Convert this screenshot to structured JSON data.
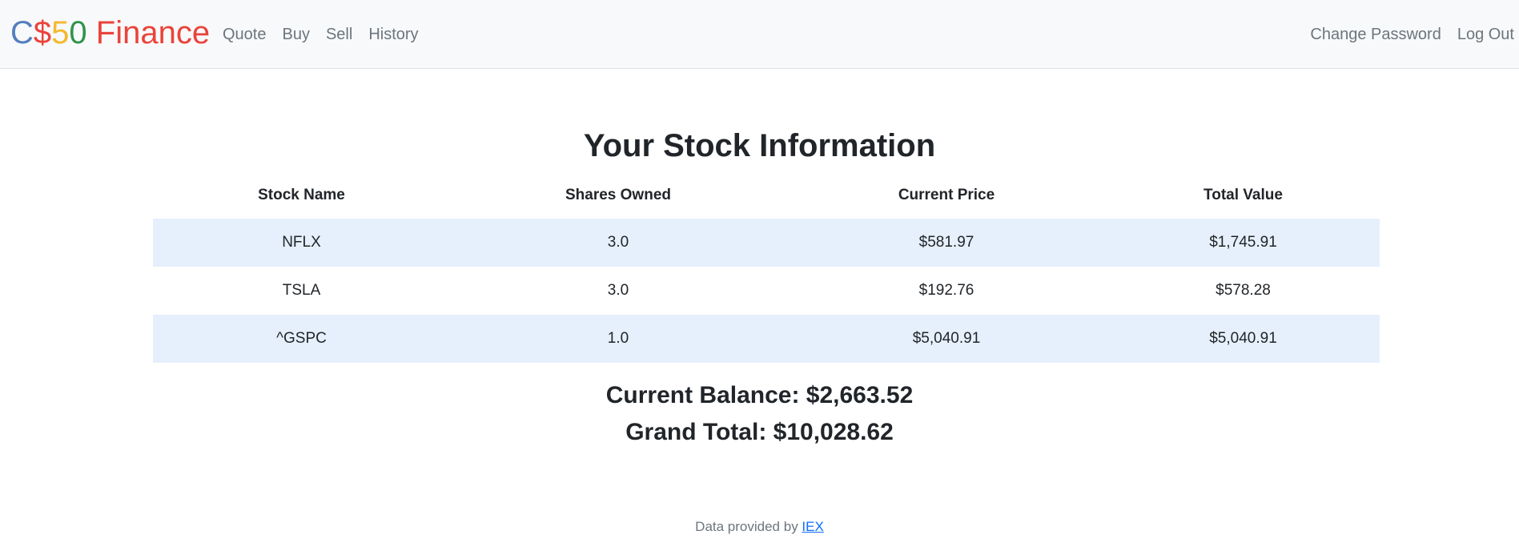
{
  "brand": {
    "c": "C",
    "dollar": "$",
    "five": "5",
    "zero": "0",
    "name": " Finance"
  },
  "nav": {
    "left": [
      "Quote",
      "Buy",
      "Sell",
      "History"
    ],
    "right": [
      "Change Password",
      "Log Out"
    ]
  },
  "main": {
    "title": "Your Stock Information",
    "headers": [
      "Stock Name",
      "Shares Owned",
      "Current Price",
      "Total Value"
    ],
    "rows": [
      [
        "NFLX",
        "3.0",
        "$581.97",
        "$1,745.91"
      ],
      [
        "TSLA",
        "3.0",
        "$192.76",
        "$578.28"
      ],
      [
        "^GSPC",
        "1.0",
        "$5,040.91",
        "$5,040.91"
      ]
    ],
    "balance": "Current Balance: $2,663.52",
    "grand_total": "Grand Total: $10,028.62"
  },
  "footer": {
    "text": "Data provided by ",
    "link": "IEX"
  }
}
